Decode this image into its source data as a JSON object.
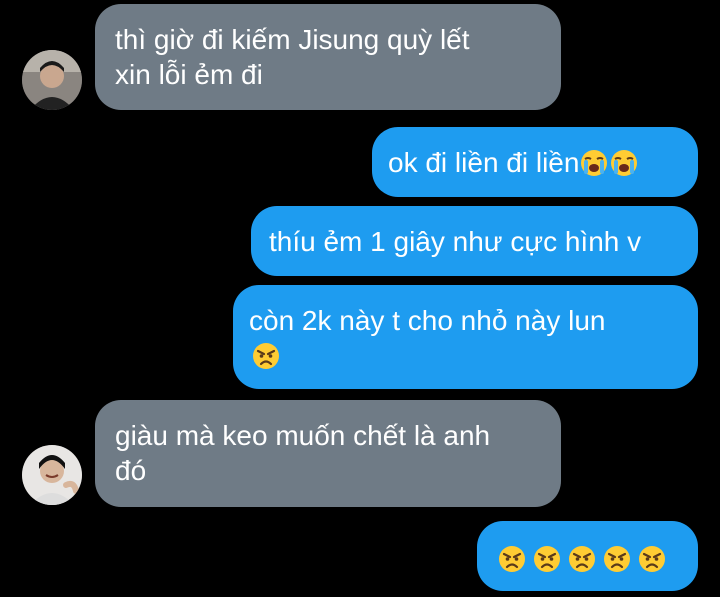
{
  "messages": [
    {
      "sender": "other",
      "lines": [
        "thì giờ đi kiếm Jisung quỳ lết",
        "xin lỗi ẻm đi"
      ]
    },
    {
      "sender": "me",
      "text": "ok đi liền đi liền",
      "emoji": [
        "loudly-crying-face",
        "loudly-crying-face"
      ]
    },
    {
      "sender": "me",
      "text": "thíu ẻm 1 giây như cực hình v"
    },
    {
      "sender": "me",
      "lines": [
        "còn 2k này t cho nhỏ này lun"
      ],
      "emoji": [
        "angry-face"
      ]
    },
    {
      "sender": "other",
      "lines": [
        "giàu mà keo muốn chết là anh",
        "đó"
      ]
    },
    {
      "sender": "me",
      "emoji": [
        "angry-face",
        "angry-face",
        "angry-face",
        "angry-face",
        "angry-face"
      ]
    }
  ],
  "colors": {
    "background": "#000000",
    "received_bubble": "#6f7b86",
    "sent_bubble": "#1e9cf0",
    "text": "#ffffff"
  }
}
